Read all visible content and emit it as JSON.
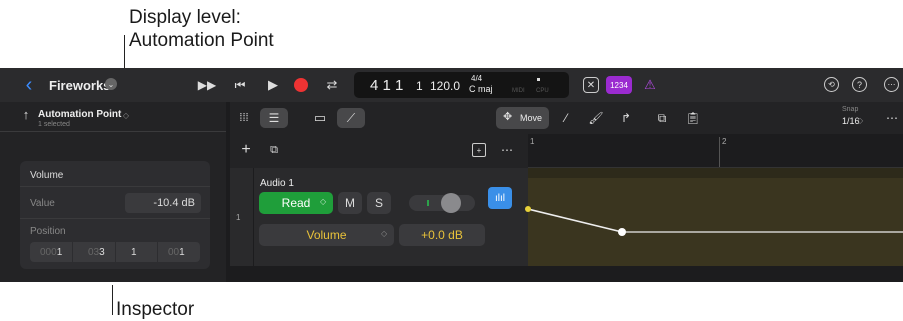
{
  "annotations": {
    "top_line1": "Display level:",
    "top_line2": "Automation Point",
    "bottom": "Inspector"
  },
  "control_bar": {
    "back_icon": "chevron-left-icon",
    "project_name": "Fireworks",
    "position": "4 1 1",
    "position_sub": "1",
    "tempo": "120.0",
    "time_sig": "4/4",
    "key": "C maj",
    "midi_label": "MIDI",
    "cpu_label": "CPU",
    "counter_label": "1234"
  },
  "inspector": {
    "header_title": "Automation Point",
    "header_sub": "1 selected",
    "section_title": "Volume",
    "value_label": "Value",
    "value": "-10.4 dB",
    "position_label": "Position",
    "position_fields": [
      "1",
      "3",
      "1",
      "1"
    ],
    "position_faint": [
      "000",
      "03",
      "",
      "00"
    ]
  },
  "tracks_toolbar": {
    "move_label": "Move",
    "snap_label": "Snap",
    "snap_value": "1/16"
  },
  "track": {
    "number": "1",
    "name": "Audio 1",
    "mode": "Read",
    "mute": "M",
    "solo": "S",
    "parameter": "Volume",
    "param_value": "+0.0 dB"
  },
  "ruler": {
    "bar1": "1",
    "bar2": "2"
  },
  "colors": {
    "accent": "#1f9e3a",
    "automation": "#3a351f",
    "selection": "#9b2bd0"
  }
}
